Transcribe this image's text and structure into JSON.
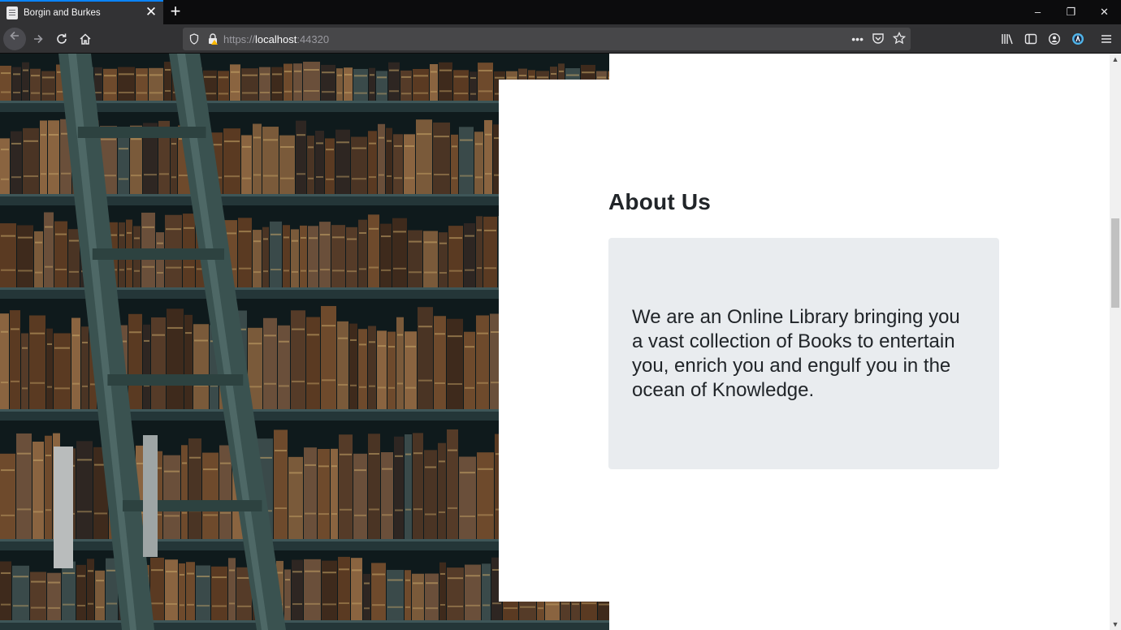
{
  "browser": {
    "tab_title": "Borgin and Burkes",
    "tab_close": "✕",
    "new_tab": "+",
    "url_scheme": "https://",
    "url_host": "localhost",
    "url_port": ":44320",
    "page_actions": "•••",
    "window": {
      "minimize": "–",
      "restore": "❐",
      "close": "✕"
    }
  },
  "page": {
    "about_heading": "About Us",
    "about_text": "We are an Online Library bringing you a vast collection of Books to entertain you, enrich you and engulf you in the ocean of Knowledge."
  },
  "colors": {
    "accent": "#0a84ff",
    "heading": "#212529",
    "card_bg": "#e9ecef"
  },
  "icons": [
    "page-icon",
    "close-icon",
    "plus-icon",
    "back-icon",
    "forward-icon",
    "reload-icon",
    "home-icon",
    "shield-icon",
    "lock-warning-icon",
    "pocket-icon",
    "bookmark-star-icon",
    "library-icon",
    "sidebar-icon",
    "account-icon",
    "extension-icon",
    "menu-icon"
  ]
}
